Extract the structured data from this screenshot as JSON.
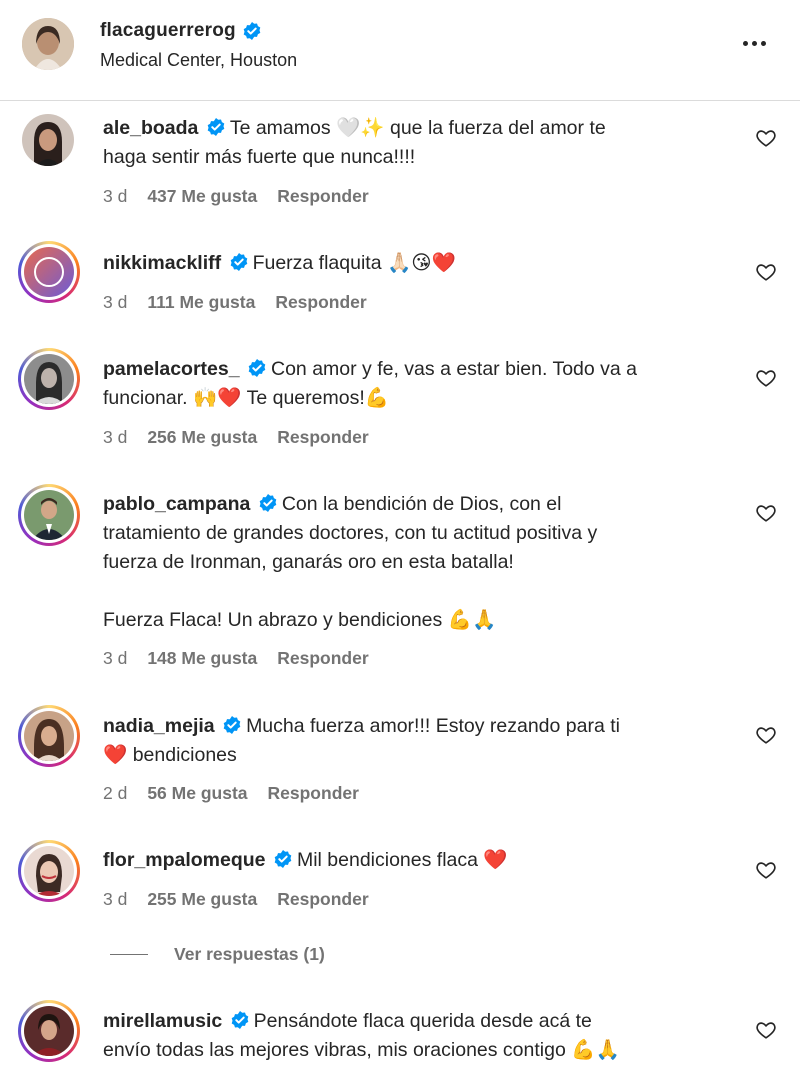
{
  "post": {
    "owner": "flacaguerrerog",
    "location": "Medical Center, Houston",
    "more_icon": "more-horizontal-icon"
  },
  "comments": [
    {
      "username": "ale_boada",
      "text_lines": [
        "Te amamos 🤍✨ que la fuerza del amor te",
        "haga sentir más fuerte que nunca!!!!"
      ],
      "time": "3 d",
      "likes": "437 Me gusta",
      "reply": "Responder"
    },
    {
      "username": "nikkimackliff",
      "text_lines": [
        "Fuerza flaquita 🙏🏻😘❤️"
      ],
      "time": "3 d",
      "likes": "111 Me gusta",
      "reply": "Responder"
    },
    {
      "username": "pamelacortes_",
      "text_lines": [
        "Con amor y fe, vas a estar bien. Todo va a",
        "funcionar. 🙌❤️ Te queremos!💪"
      ],
      "time": "3 d",
      "likes": "256 Me gusta",
      "reply": "Responder"
    },
    {
      "username": "pablo_campana",
      "text_lines": [
        "Con la bendición de Dios, con el",
        "tratamiento de grandes doctores, con tu actitud positiva y",
        "fuerza de Ironman, ganarás oro en esta batalla!",
        "",
        "Fuerza Flaca! Un abrazo y bendiciones 💪🙏"
      ],
      "time": "3 d",
      "likes": "148 Me gusta",
      "reply": "Responder"
    },
    {
      "username": "nadia_mejia",
      "text_lines": [
        "Mucha fuerza amor!!! Estoy rezando para ti",
        "❤️ bendiciones"
      ],
      "time": "2 d",
      "likes": "56 Me gusta",
      "reply": "Responder"
    },
    {
      "username": "flor_mpalomeque",
      "text_lines": [
        "Mil bendiciones flaca ❤️"
      ],
      "time": "3 d",
      "likes": "255 Me gusta",
      "reply": "Responder"
    },
    {
      "username": "mirellamusic",
      "text_lines": [
        "Pensándote flaca querida desde acá te",
        "envío todas las mejores vibras, mis oraciones contigo 💪🙏"
      ],
      "time": "",
      "likes": "",
      "reply": ""
    }
  ],
  "view_replies": "Ver respuestas (1)",
  "colors": {
    "verified": "#0095f6",
    "meta": "#737373",
    "text": "#262626",
    "story_ring": [
      "#feda75",
      "#fa7e1e",
      "#d62976",
      "#962fbf",
      "#4f5bd5"
    ]
  },
  "icons": [
    "verified-badge-icon",
    "heart-outline-icon",
    "more-horizontal-icon"
  ]
}
